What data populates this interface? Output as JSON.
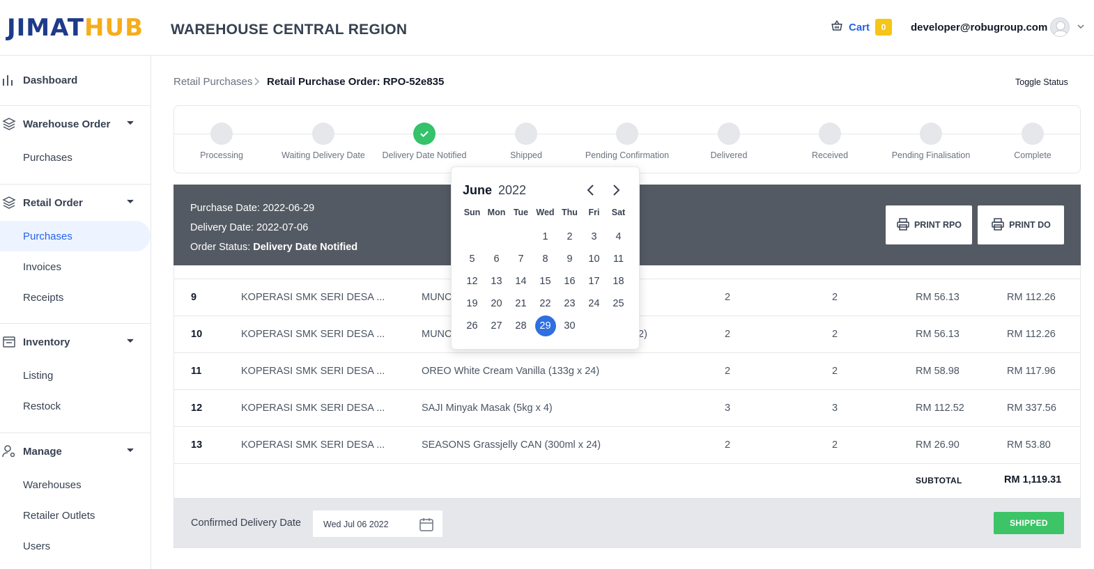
{
  "brand": {
    "logo_part1": "JIMAT",
    "logo_part2": "HUB",
    "region": "WAREHOUSE CENTRAL REGION"
  },
  "header": {
    "cart_label": "Cart",
    "cart_count": "0",
    "user_email": "developer@robugroup.com"
  },
  "sidebar": {
    "dashboard": "Dashboard",
    "warehouse_order": "Warehouse Order",
    "warehouse_purchases": "Purchases",
    "retail_order": "Retail Order",
    "retail_purchases": "Purchases",
    "invoices": "Invoices",
    "receipts": "Receipts",
    "inventory": "Inventory",
    "listing": "Listing",
    "restock": "Restock",
    "manage": "Manage",
    "warehouses": "Warehouses",
    "retailer_outlets": "Retailer Outlets",
    "users": "Users"
  },
  "breadcrumb": {
    "parent": "Retail Purchases",
    "current": "Retail Purchase Order: RPO-52e835"
  },
  "toggle_status": "Toggle Status",
  "steps": [
    "Processing",
    "Waiting Delivery Date",
    "Delivery Date Notified",
    "Shipped",
    "Pending Confirmation",
    "Delivered",
    "Received",
    "Pending Finalisation",
    "Complete"
  ],
  "order": {
    "purchase_date": "Purchase Date: 2022-06-29",
    "delivery_date": "Delivery Date: 2022-07-06",
    "status_label": "Order Status: ",
    "status_value": "Delivery Date Notified",
    "print_rpo": "PRINT RPO",
    "print_do": "PRINT DO"
  },
  "rows": [
    {
      "num": "9",
      "coop": "KOPERASI SMK SERI DESA ...",
      "product": "MUNC",
      "q1": "2",
      "q2": "2",
      "price": "RM 56.13",
      "total": "RM 112.26"
    },
    {
      "num": "10",
      "coop": "KOPERASI SMK SERI DESA ...",
      "product": "MUNC",
      "product_tail": "2)",
      "q1": "2",
      "q2": "2",
      "price": "RM 56.13",
      "total": "RM 112.26"
    },
    {
      "num": "11",
      "coop": "KOPERASI SMK SERI DESA ...",
      "product": "OREO White Cream Vanilla (133g x 24)",
      "q1": "2",
      "q2": "2",
      "price": "RM 58.98",
      "total": "RM 117.96"
    },
    {
      "num": "12",
      "coop": "KOPERASI SMK SERI DESA ...",
      "product": "SAJI Minyak Masak (5kg x 4)",
      "q1": "3",
      "q2": "3",
      "price": "RM 112.52",
      "total": "RM 337.56"
    },
    {
      "num": "13",
      "coop": "KOPERASI SMK SERI DESA ...",
      "product": "SEASONS Grassjelly CAN (300ml x 24)",
      "q1": "2",
      "q2": "2",
      "price": "RM 26.90",
      "total": "RM 53.80"
    }
  ],
  "subtotal": {
    "label": "SUBTOTAL",
    "value": "RM 1,119.31"
  },
  "footer": {
    "confirm_label": "Confirmed Delivery Date",
    "date_value": "Wed Jul 06 2022",
    "shipped_button": "SHIPPED"
  },
  "datepicker": {
    "month": "June",
    "year": "2022",
    "weekdays": [
      "Sun",
      "Mon",
      "Tue",
      "Wed",
      "Thu",
      "Fri",
      "Sat"
    ],
    "weeks": [
      [
        "",
        "",
        "",
        "1",
        "2",
        "3",
        "4"
      ],
      [
        "5",
        "6",
        "7",
        "8",
        "9",
        "10",
        "11"
      ],
      [
        "12",
        "13",
        "14",
        "15",
        "16",
        "17",
        "18"
      ],
      [
        "19",
        "20",
        "21",
        "22",
        "23",
        "24",
        "25"
      ],
      [
        "26",
        "27",
        "28",
        "29",
        "30",
        "",
        ""
      ]
    ],
    "selected": "29"
  },
  "colors": {
    "accent": "#2563eb",
    "success": "#34c26b",
    "info_bar": "#545a63",
    "logo_blue": "#1e3a8a",
    "logo_orange": "#f6ad1b",
    "cart_badge": "#f5c518"
  },
  "icons": [
    "cart-icon",
    "chart-icon",
    "layers-icon",
    "inventory-icon",
    "manage-icon",
    "chevron-down-icon",
    "check-icon",
    "printer-icon",
    "calendar-icon",
    "chevron-left-icon",
    "chevron-right-icon"
  ]
}
